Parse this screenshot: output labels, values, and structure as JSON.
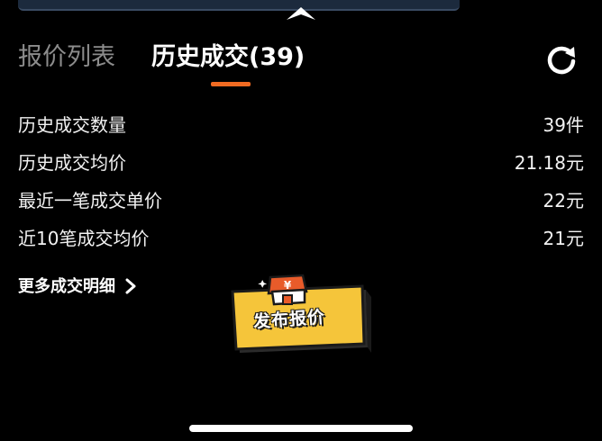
{
  "tabs": {
    "quotes_label": "报价列表",
    "history_label": "历史成交(39)",
    "active": "history"
  },
  "stats": [
    {
      "label": "历史成交数量",
      "value": "39件"
    },
    {
      "label": "历史成交均价",
      "value": "21.18元"
    },
    {
      "label": "最近一笔成交单价",
      "value": "22元"
    },
    {
      "label": "近10笔成交均价",
      "value": "21元"
    }
  ],
  "more_link": {
    "label": "更多成交明细"
  },
  "publish_button": {
    "label": "发布报价",
    "badge_symbol": "¥"
  },
  "icons": {
    "refresh": "refresh-icon",
    "chevron": "chevron-right-icon",
    "caret": "caret-up-icon"
  },
  "colors": {
    "accent": "#f26b22",
    "publish_yellow": "#f5c53a",
    "background": "#000000"
  }
}
